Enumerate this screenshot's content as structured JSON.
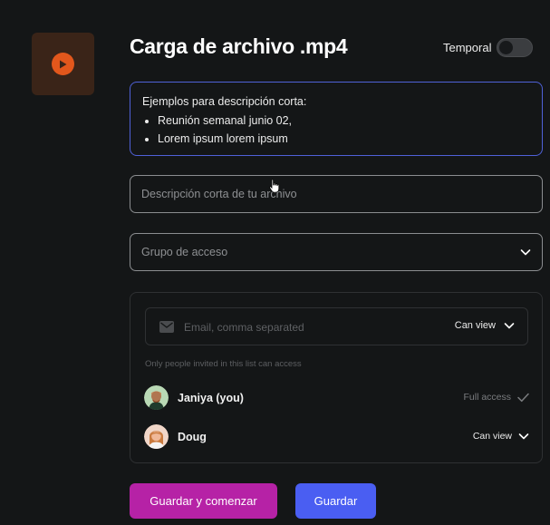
{
  "header": {
    "title": "Carga de archivo .mp4",
    "temporal_label": "Temporal",
    "temporal_on": false
  },
  "file": {
    "icon": "play-icon",
    "thumb_color": "#3a2418",
    "accent": "#e2571c"
  },
  "examples": {
    "heading": "Ejemplos para descripción corta:",
    "items": [
      "Reunión semanal junio 02,",
      "Lorem ipsum lorem ipsum"
    ]
  },
  "form": {
    "description_placeholder": "Descripción corta de tu archivo",
    "group_placeholder": "Grupo de acceso"
  },
  "share": {
    "email_placeholder": "Email, comma separated",
    "default_permission": "Can view",
    "hint": "Only people invited in this list can access",
    "people": [
      {
        "name": "Janiya (you)",
        "access": "Full access"
      },
      {
        "name": "Doug",
        "access": "Can view"
      }
    ]
  },
  "actions": {
    "save_and_start": "Guardar y comenzar",
    "save": "Guardar"
  },
  "colors": {
    "background": "#141617",
    "primary_blue": "#4a5ef2",
    "magenta": "#b622a6",
    "focus_border": "#4f61d8"
  }
}
